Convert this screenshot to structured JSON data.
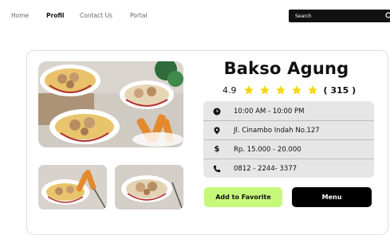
{
  "nav": {
    "items": [
      {
        "label": "Home",
        "active": false
      },
      {
        "label": "Profil",
        "active": true
      },
      {
        "label": "Contact Us",
        "active": false
      },
      {
        "label": "Portal",
        "active": false
      }
    ]
  },
  "search": {
    "placeholder": "Search"
  },
  "restaurant": {
    "name": "Bakso Agung",
    "rating": "4.9",
    "stars": 5,
    "review_count": "( 315 )",
    "hours": "10:00 AM - 10:00 PM",
    "address": "Jl. Cinambo Indah No.127",
    "price": "Rp. 15.000 - 20.000",
    "phone": "0812 - 2244- 3377"
  },
  "buttons": {
    "favorite": "Add to Favorite",
    "menu": "Menu"
  },
  "icons": {
    "search": "search-icon",
    "clock": "clock-icon",
    "pin": "location-pin-icon",
    "dollar": "dollar-icon",
    "phone": "phone-icon",
    "star": "star-icon"
  },
  "colors": {
    "accent": "#c6f97a",
    "star": "#f5d70a",
    "dark": "#000000",
    "info_bg": "#e6e6e6"
  }
}
